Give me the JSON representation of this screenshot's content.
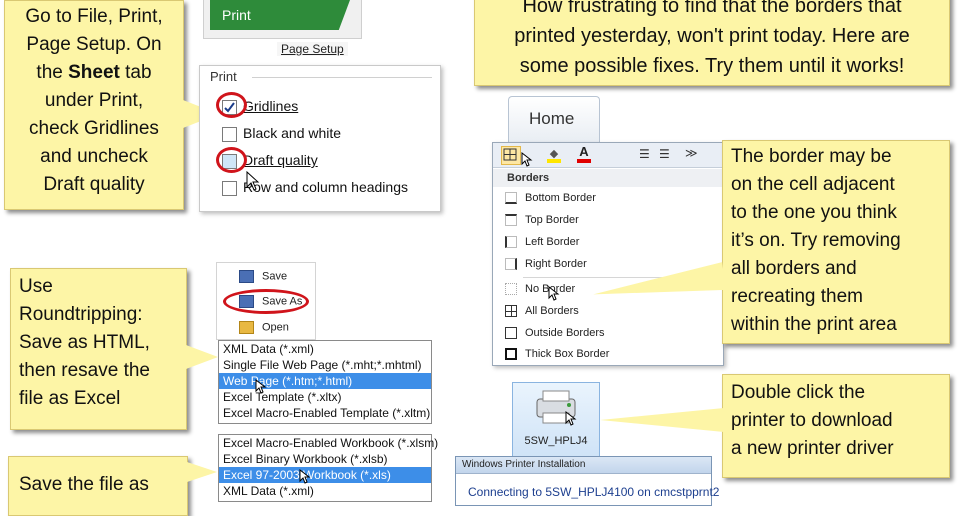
{
  "print_ribbon": {
    "tab_label": "Print",
    "page_setup_link": "Page Setup"
  },
  "sheet_print": {
    "group_label": "Print",
    "options": [
      {
        "label": "Gridlines",
        "checked": true
      },
      {
        "label": "Black and white",
        "checked": false
      },
      {
        "label": "Draft quality",
        "checked": false
      },
      {
        "label": "Row and column headings",
        "checked": false
      }
    ]
  },
  "notes": {
    "page_setup": [
      "Go to File, Print,",
      "Page Setup. On",
      "the",
      "Sheet",
      "tab",
      "under Print,",
      "check Gridlines",
      "and uncheck",
      "Draft quality"
    ],
    "intro": [
      "How frustrating to find that the borders that",
      "printed yesterday, won't print today.  Here are",
      "some possible fixes. Try them until it works!"
    ],
    "border": [
      "The border may be",
      "on the cell adjacent",
      "to the one you think",
      "it’s on. Try removing",
      "all borders and",
      "recreating them",
      "within the print area"
    ],
    "roundtrip": [
      "Use",
      "Roundtripping:",
      "Save as HTML,",
      "then resave the",
      "file as Excel"
    ],
    "printer": [
      "Double click the",
      "printer to download",
      "a new printer driver"
    ],
    "save_file": [
      "Save the file as"
    ]
  },
  "home_tab": {
    "label": "Home"
  },
  "borders_menu": {
    "header": "Borders",
    "items": [
      "Bottom Border",
      "Top Border",
      "Left Border",
      "Right Border",
      "No Border",
      "All Borders",
      "Outside Borders",
      "Thick Box Border"
    ]
  },
  "file_menu": {
    "items": [
      "Save",
      "Save As",
      "Open"
    ]
  },
  "save_types_1": {
    "items": [
      "XML Data (*.xml)",
      "Single File Web Page (*.mht;*.mhtml)",
      "Web Page (*.htm;*.html)",
      "Excel Template (*.xltx)",
      "Excel Macro-Enabled Template (*.xltm)"
    ],
    "selected_index": 2
  },
  "save_types_2": {
    "items": [
      "Excel Macro-Enabled Workbook (*.xlsm)",
      "Excel Binary Workbook (*.xlsb)",
      "Excel 97-2003 Workbook (*.xls)",
      "XML Data (*.xml)"
    ],
    "selected_index": 2
  },
  "printer_icon": {
    "label": "5SW_HPLJ4"
  },
  "printer_install": {
    "title": "Windows Printer Installation",
    "status": "Connecting to 5SW_HPLJ4100 on cmcstpprnt2"
  },
  "colors": {
    "note_bg": "#fdf5a6",
    "highlight_ring": "#d0141b",
    "selection": "#3d8ee8",
    "ribbon_green": "#2e8b3a"
  }
}
